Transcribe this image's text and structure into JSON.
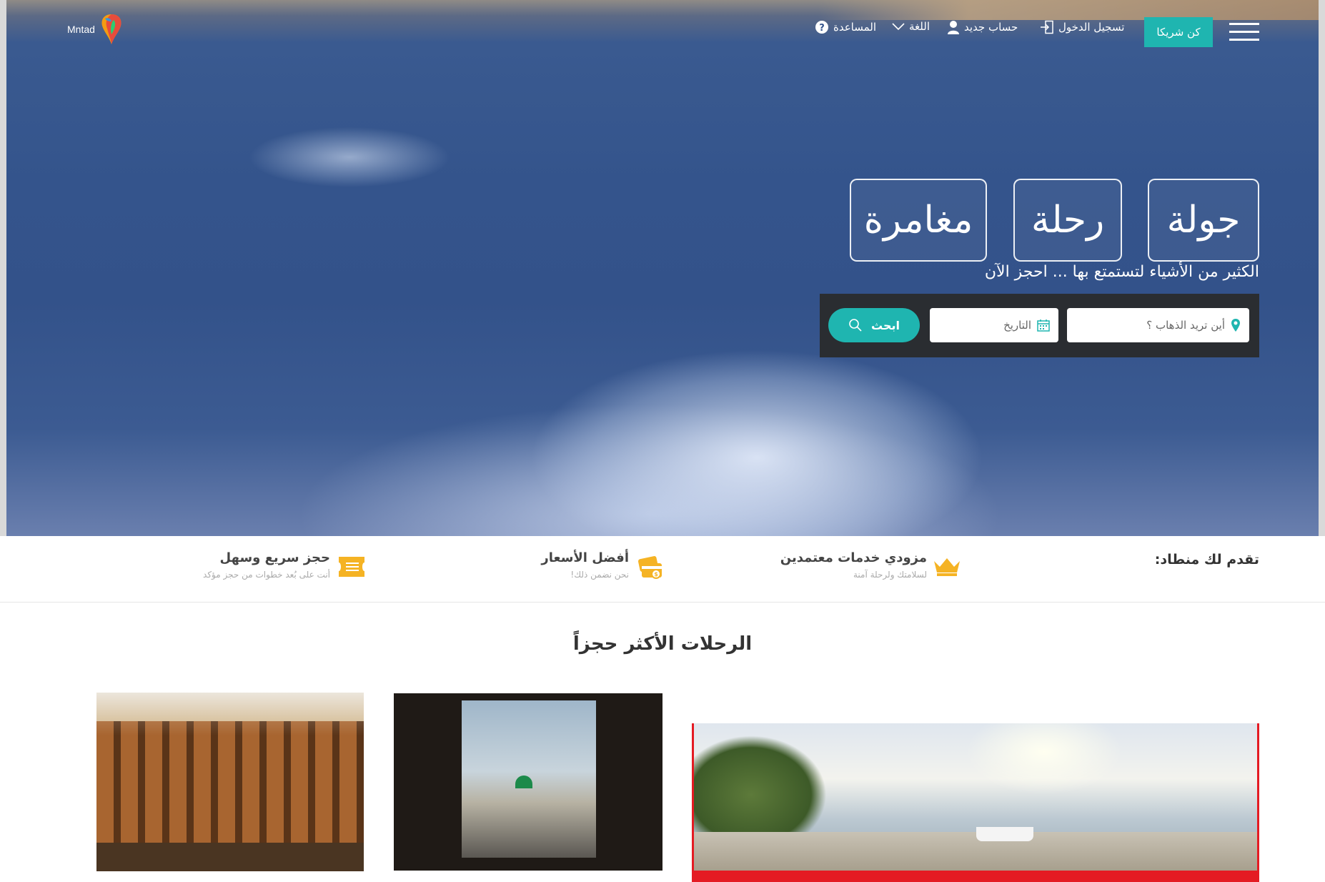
{
  "brand": {
    "logo_text": "Mntad",
    "accent": "#1fb5b0",
    "dark_bar": "#2a2d31"
  },
  "header": {
    "help": "المساعدة",
    "language": "اللغة",
    "signup": "حساب جديد",
    "login": "تسجيل الدخول",
    "partner": "كن شريكا"
  },
  "hero": {
    "categories": [
      "جولة",
      "رحلة",
      "مغامرة"
    ],
    "tagline": "الكثير من الأشياء لتستمتع بها ... احجز الآن",
    "search": {
      "destination_placeholder": "أين تريد الذهاب ؟",
      "date_placeholder": "التاريخ",
      "button": "ابحث"
    }
  },
  "features": {
    "title": "تقدم لك منطاد:",
    "items": [
      {
        "title": "مزودي خدمات معتمدين",
        "subtitle": "لسلامتك ولرحلة آمنة",
        "icon": "crown-icon"
      },
      {
        "title": "أفضل الأسعار",
        "subtitle": "نحن نضمن ذلك!",
        "icon": "price-card-icon"
      },
      {
        "title": "حجز سريع وسهل",
        "subtitle": "أنت على بُعد خطوات من حجز مؤكد",
        "icon": "ticket-icon"
      }
    ]
  },
  "most_booked": {
    "title": "الرحلات الأكثر حجزاً"
  }
}
